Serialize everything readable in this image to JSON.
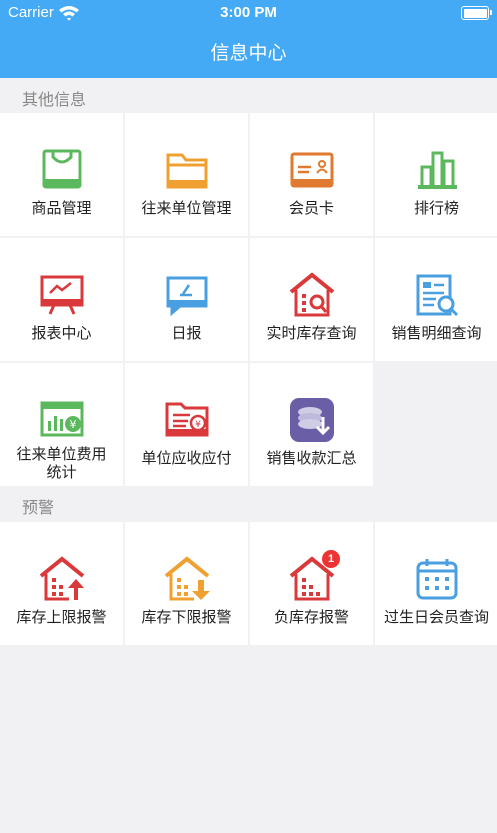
{
  "status_bar": {
    "carrier": "Carrier",
    "time": "3:00 PM"
  },
  "nav": {
    "title": "信息中心"
  },
  "colors": {
    "accent": "#44aaf6",
    "green": "#5cb85c",
    "orange": "#f0a030",
    "red": "#d9393b",
    "blue": "#4a9fe0",
    "purple": "#6a5fa6"
  },
  "sections": [
    {
      "title": "其他信息",
      "items": [
        {
          "label": "商品管理",
          "icon": "shopping-bag-icon"
        },
        {
          "label": "往来单位管理",
          "icon": "folder-icon"
        },
        {
          "label": "会员卡",
          "icon": "member-card-icon"
        },
        {
          "label": "排行榜",
          "icon": "bar-chart-icon"
        },
        {
          "label": "报表中心",
          "icon": "report-board-icon"
        },
        {
          "label": "日报",
          "icon": "daily-report-icon"
        },
        {
          "label": "实时库存查询",
          "icon": "warehouse-search-icon"
        },
        {
          "label": "销售明细查询",
          "icon": "document-search-icon"
        },
        {
          "label": "往来单位费用统计",
          "icon": "expense-stats-icon"
        },
        {
          "label": "单位应收应付",
          "icon": "receivable-folder-icon"
        },
        {
          "label": "销售收款汇总",
          "icon": "sales-summary-icon"
        }
      ]
    },
    {
      "title": "预警",
      "items": [
        {
          "label": "库存上限报警",
          "icon": "stock-upper-alert-icon"
        },
        {
          "label": "库存下限报警",
          "icon": "stock-lower-alert-icon"
        },
        {
          "label": "负库存报警",
          "icon": "negative-stock-alert-icon",
          "badge": "1"
        },
        {
          "label": "过生日会员查询",
          "icon": "birthday-calendar-icon"
        }
      ]
    }
  ]
}
